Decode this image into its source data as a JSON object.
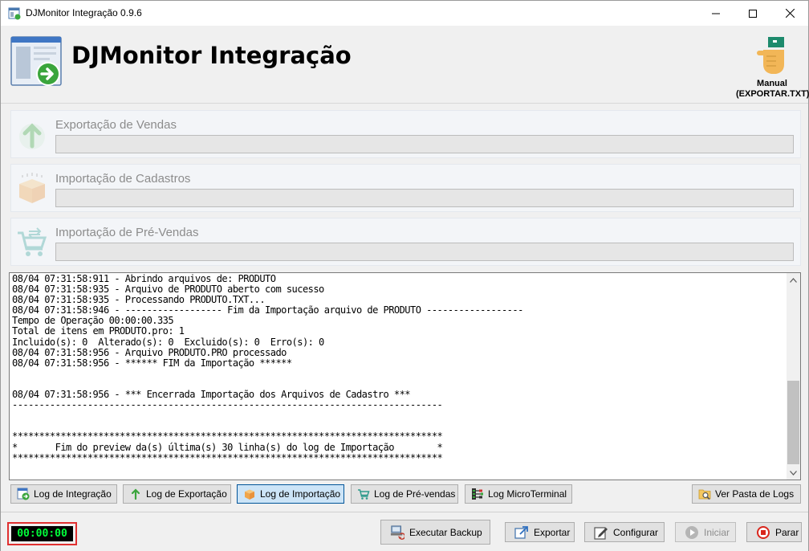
{
  "window": {
    "title": "DJMonitor Integração 0.9.6",
    "controls": {
      "minimize": "minimize-icon",
      "maximize": "maximize-icon",
      "close": "close-icon"
    }
  },
  "header": {
    "app_title": "DJMonitor Integração",
    "manual_button": {
      "line1": "Manual",
      "line2": "(EXPORTAR.TXT)",
      "icon": "hand-pointing-icon"
    }
  },
  "tasks": [
    {
      "label": "Exportação de Vendas",
      "icon": "upload-arrow-icon",
      "progress": 0
    },
    {
      "label": "Importação de Cadastros",
      "icon": "box-icon",
      "progress": 0
    },
    {
      "label": "Importação de Pré-Vendas",
      "icon": "cart-icon",
      "progress": 0
    }
  ],
  "log": {
    "lines": [
      "08/04 07:31:58:911 - Abrindo arquivos de: PRODUTO",
      "08/04 07:31:58:935 - Arquivo de PRODUTO aberto com sucesso",
      "08/04 07:31:58:935 - Processando PRODUTO.TXT...",
      "08/04 07:31:58:946 - ------------------ Fim da Importação arquivo de PRODUTO ------------------",
      "Tempo de Operação 00:00:00.335",
      "Total de itens em PRODUTO.pro: 1",
      "Incluido(s): 0  Alterado(s): 0  Excluido(s): 0  Erro(s): 0",
      "08/04 07:31:58:956 - Arquivo PRODUTO.PRO processado",
      "08/04 07:31:58:956 - ****** FIM da Importação ******",
      "",
      "",
      "08/04 07:31:58:956 - *** Encerrada Importação dos Arquivos de Cadastro ***",
      "--------------------------------------------------------------------------------",
      "",
      "",
      "********************************************************************************",
      "*       Fim do preview da(s) última(s) 30 linha(s) do log de Importação        *",
      "********************************************************************************"
    ]
  },
  "log_buttons": [
    {
      "label": "Log de Integração",
      "icon": "log-integration-icon",
      "active": false
    },
    {
      "label": "Log de Exportação",
      "icon": "up-arrow-icon",
      "active": false
    },
    {
      "label": "Log de Importação",
      "icon": "box-icon",
      "active": true
    },
    {
      "label": "Log de Pré-vendas",
      "icon": "cart-icon",
      "active": false
    },
    {
      "label": "Log MicroTerminal",
      "icon": "terminal-icon",
      "active": false
    },
    {
      "label": "Ver Pasta de Logs",
      "icon": "folder-search-icon",
      "active": false
    }
  ],
  "bottom": {
    "timer": "00:00:00",
    "buttons": {
      "backup": "Executar Backup",
      "export": "Exportar",
      "configure": "Configurar",
      "start": "Iniciar",
      "stop": "Parar"
    }
  },
  "colors": {
    "accent_active": "#cce4f7",
    "timer_text": "#00ff3a",
    "timer_border": "#e03030",
    "stop_red": "#d9261c"
  }
}
